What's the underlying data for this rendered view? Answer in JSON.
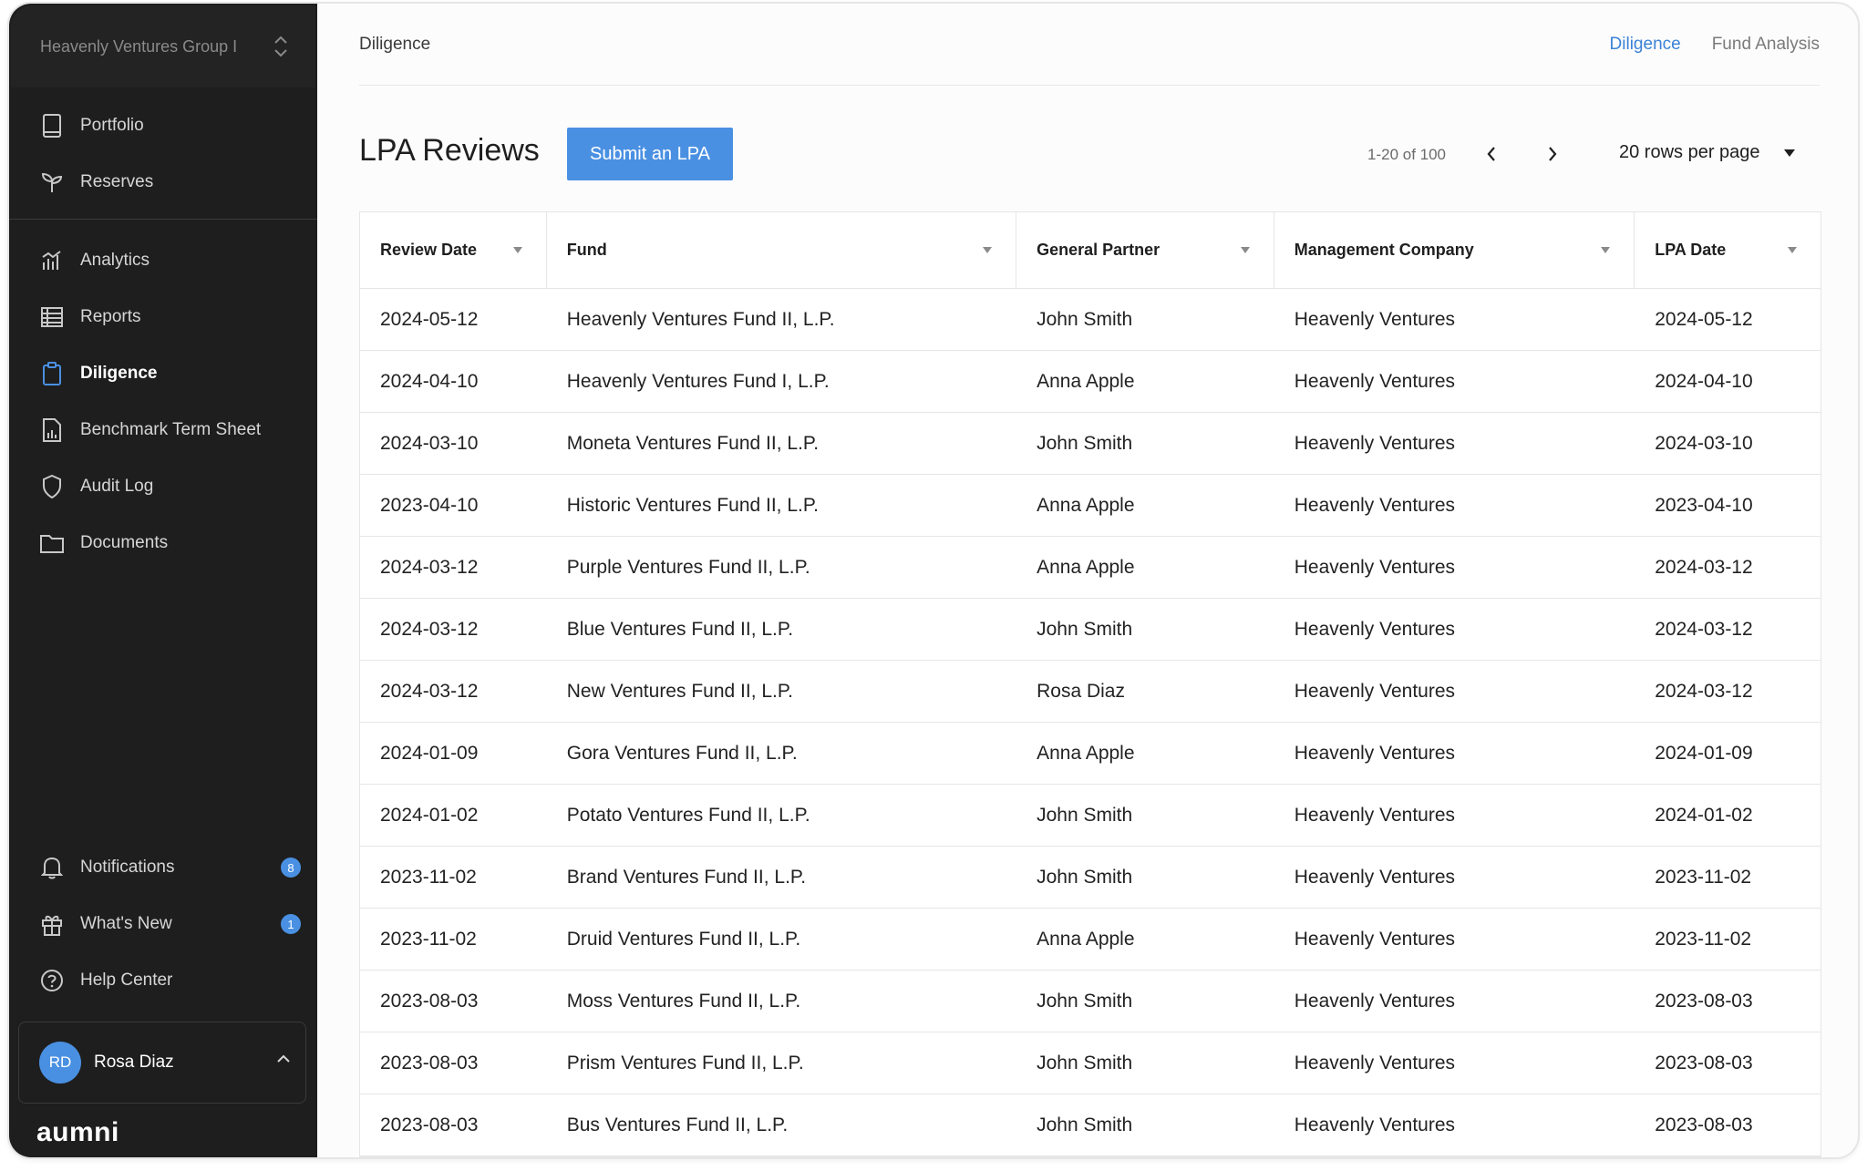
{
  "sidebar": {
    "org_name": "Heavenly Ventures Group I",
    "nav": [
      {
        "label": "Portfolio",
        "icon": "tablet-icon"
      },
      {
        "label": "Reserves",
        "icon": "sprout-icon"
      },
      {
        "label": "Analytics",
        "icon": "bar-chart-icon"
      },
      {
        "label": "Reports",
        "icon": "table-icon"
      },
      {
        "label": "Diligence",
        "icon": "clipboard-icon",
        "active": true
      },
      {
        "label": "Benchmark Term Sheet",
        "icon": "document-chart-icon"
      },
      {
        "label": "Audit Log",
        "icon": "shield-icon"
      },
      {
        "label": "Documents",
        "icon": "folder-icon"
      }
    ],
    "bottom": [
      {
        "label": "Notifications",
        "icon": "bell-icon",
        "badge": "8"
      },
      {
        "label": "What's New",
        "icon": "gift-icon",
        "badge": "1"
      },
      {
        "label": "Help Center",
        "icon": "help-circle-icon"
      }
    ],
    "user": {
      "initials": "RD",
      "name": "Rosa Diaz"
    },
    "logo": "aumni"
  },
  "header": {
    "breadcrumb": "Diligence",
    "tabs": [
      {
        "label": "Diligence",
        "active": true
      },
      {
        "label": "Fund Analysis",
        "active": false
      }
    ]
  },
  "page": {
    "title": "LPA Reviews",
    "submit_label": "Submit an LPA",
    "pager_range": "1-20 of 100",
    "rows_per_page": "20 rows per page"
  },
  "table": {
    "columns": [
      "Review Date",
      "Fund",
      "General Partner",
      "Management Company",
      "LPA Date"
    ],
    "rows": [
      [
        "2024-05-12",
        "Heavenly Ventures Fund II, L.P.",
        "John Smith",
        "Heavenly Ventures",
        "2024-05-12"
      ],
      [
        "2024-04-10",
        "Heavenly Ventures Fund I, L.P.",
        "Anna Apple",
        "Heavenly Ventures",
        "2024-04-10"
      ],
      [
        "2024-03-10",
        "Moneta Ventures Fund II, L.P.",
        "John Smith",
        "Heavenly Ventures",
        "2024-03-10"
      ],
      [
        "2023-04-10",
        "Historic Ventures Fund II, L.P.",
        "Anna Apple",
        "Heavenly Ventures",
        "2023-04-10"
      ],
      [
        "2024-03-12",
        "Purple Ventures Fund II, L.P.",
        "Anna Apple",
        "Heavenly Ventures",
        "2024-03-12"
      ],
      [
        "2024-03-12",
        "Blue Ventures Fund II, L.P.",
        "John Smith",
        "Heavenly Ventures",
        "2024-03-12"
      ],
      [
        "2024-03-12",
        "New Ventures Fund II, L.P.",
        "Rosa Diaz",
        "Heavenly Ventures",
        "2024-03-12"
      ],
      [
        "2024-01-09",
        "Gora Ventures Fund II, L.P.",
        "Anna Apple",
        "Heavenly Ventures",
        "2024-01-09"
      ],
      [
        "2024-01-02",
        "Potato Ventures Fund II, L.P.",
        "John Smith",
        "Heavenly Ventures",
        "2024-01-02"
      ],
      [
        "2023-11-02",
        "Brand Ventures Fund II, L.P.",
        "John Smith",
        "Heavenly Ventures",
        "2023-11-02"
      ],
      [
        "2023-11-02",
        "Druid Ventures Fund II, L.P.",
        "Anna Apple",
        "Heavenly Ventures",
        "2023-11-02"
      ],
      [
        "2023-08-03",
        "Moss Ventures Fund II, L.P.",
        "John Smith",
        "Heavenly Ventures",
        "2023-08-03"
      ],
      [
        "2023-08-03",
        "Prism Ventures Fund II, L.P.",
        "John Smith",
        "Heavenly Ventures",
        "2023-08-03"
      ],
      [
        "2023-08-03",
        "Bus Ventures Fund II, L.P.",
        "John Smith",
        "Heavenly Ventures",
        "2023-08-03"
      ]
    ]
  },
  "colors": {
    "accent": "#4a90e2",
    "sidebar_bg": "#1e1e1e",
    "active_tab": "#3b82d6"
  }
}
